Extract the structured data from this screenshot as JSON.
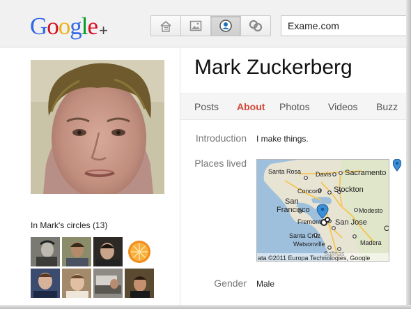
{
  "header": {
    "logo_text": "Google",
    "logo_plus": "+",
    "nav_buttons": [
      "home-icon",
      "photos-icon",
      "profile-icon",
      "circles-icon"
    ],
    "search_value": "Exame.com"
  },
  "profile": {
    "name": "Mark Zuckerberg",
    "tabs": [
      {
        "label": "Posts",
        "active": false
      },
      {
        "label": "About",
        "active": true
      },
      {
        "label": "Photos",
        "active": false
      },
      {
        "label": "Videos",
        "active": false
      },
      {
        "label": "Buzz",
        "active": false
      }
    ],
    "introduction_label": "Introduction",
    "introduction_value": "I make things.",
    "places_label": "Places lived",
    "gender_label": "Gender",
    "gender_value": "Male",
    "circles_title": "In Mark's circles (13)"
  },
  "map": {
    "labels": [
      "Santa Rosa",
      "Davis",
      "Sacramento",
      "Concord",
      "Stockton",
      "San",
      "Francisco",
      "Modesto",
      "Fremont",
      "San Jose",
      "Santa Cruz",
      "Watsonville",
      "Madera",
      "Salinas",
      "C"
    ],
    "copyright": "ata ©2011 Europa Technologies, Google"
  },
  "colors": {
    "active_tab": "#d14836",
    "topbar_bg": "#f1f1f1",
    "tabs_bg": "#f5f5f5"
  }
}
